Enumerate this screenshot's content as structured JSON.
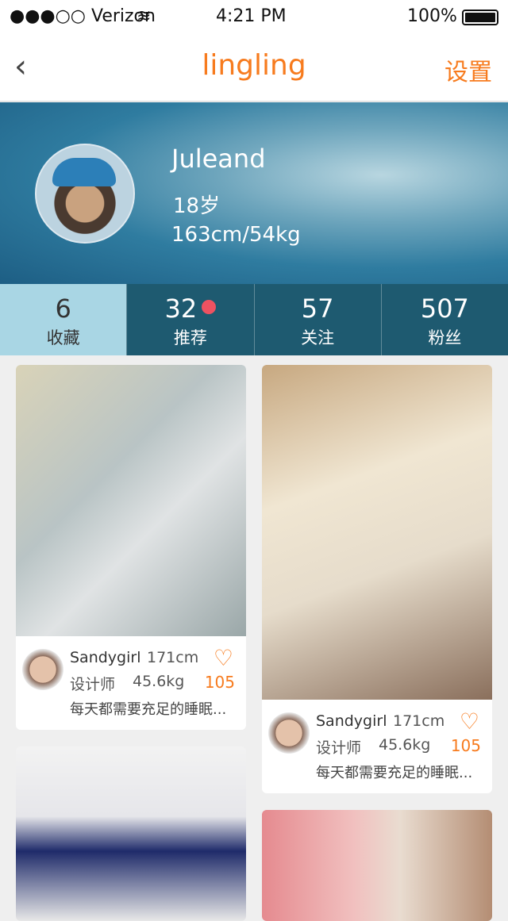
{
  "status_bar": {
    "carrier": "●●●○○ Verizon",
    "time": "4:21 PM",
    "battery": "100%"
  },
  "nav": {
    "back_icon": "‹",
    "title": "lingling",
    "settings": "设置"
  },
  "profile": {
    "name": "Juleand",
    "age": "18岁",
    "height_weight": "163cm/54kg"
  },
  "stats": [
    {
      "count": "6",
      "label": "收藏"
    },
    {
      "count": "32",
      "label": "推荐"
    },
    {
      "count": "57",
      "label": "关注"
    },
    {
      "count": "507",
      "label": "粉丝"
    }
  ],
  "cards": [
    {
      "name": "Sandygirl",
      "height": "171cm",
      "role": "设计师",
      "weight": "45.6kg",
      "likes": "105",
      "desc": "每天都需要充足的睡眠..."
    },
    {
      "name": "Sandygirl",
      "height": "171cm",
      "role": "设计师",
      "weight": "45.6kg",
      "likes": "105",
      "desc": "每天都需要充足的睡眠..."
    }
  ]
}
